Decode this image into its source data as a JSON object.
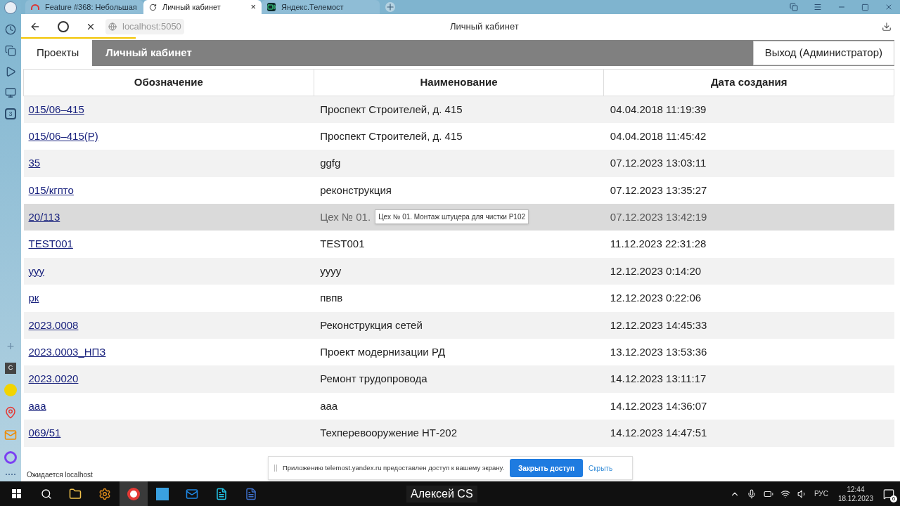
{
  "browser": {
    "tabs": [
      {
        "title": "Feature #368: Небольшая",
        "selected": false
      },
      {
        "title": "Личный кабинет",
        "selected": true,
        "close": "×"
      },
      {
        "title": "Яндекс.Телемост",
        "selected": false
      }
    ],
    "address": "localhost:5050",
    "page_title": "Личный кабинет",
    "load": {
      "level": 0.13
    },
    "status": "Ожидается localhost"
  },
  "page": {
    "tabs": [
      {
        "label": "Проекты",
        "selected": true
      },
      {
        "label": "Личный кабинет",
        "selected": false
      }
    ],
    "logout_button": "Выход (Администратор)",
    "table": {
      "columns": [
        "Обозначение",
        "Наименование",
        "Дата создания"
      ],
      "rows": [
        {
          "code": "015/06–415",
          "name": "Проспект Строителей, д. 415",
          "date": "04.04.2018 11:19:39",
          "hovered": false
        },
        {
          "code": "015/06–415(Р)",
          "name": "Проспект Строителей, д. 415",
          "date": "04.04.2018 11:45:42",
          "hovered": false
        },
        {
          "code": "35",
          "name": "ggfg",
          "date": "07.12.2023 13:03:11",
          "hovered": false
        },
        {
          "code": "015/кгпто",
          "name": "реконструкция",
          "date": "07.12.2023 13:35:27",
          "hovered": false
        },
        {
          "code": "20/113",
          "name": "Цех № 01.",
          "date": "07.12.2023 13:42:19",
          "hovered": true,
          "tooltip": "Цех № 01. Монтаж штуцера для чистки Р102"
        },
        {
          "code": "TEST001",
          "name": "TEST001",
          "date": "11.12.2023 22:31:28",
          "hovered": false
        },
        {
          "code": "ууу",
          "name": "уууу",
          "date": "12.12.2023 0:14:20",
          "hovered": false
        },
        {
          "code": "рк",
          "name": "пвпв",
          "date": "12.12.2023 0:22:06",
          "hovered": false
        },
        {
          "code": "2023.0008",
          "name": "Реконструкция сетей",
          "date": "12.12.2023 14:45:33",
          "hovered": false
        },
        {
          "code": "2023.0003_НПЗ",
          "name": "Проект модернизации РД",
          "date": "13.12.2023 13:53:36",
          "hovered": false
        },
        {
          "code": "2023.0020",
          "name": "Ремонт трудопровода",
          "date": "14.12.2023 13:11:17",
          "hovered": false
        },
        {
          "code": "ааа",
          "name": "ааа",
          "date": "14.12.2023 14:36:07",
          "hovered": false
        },
        {
          "code": "069/51",
          "name": "Техперевооружение НТ-202",
          "date": "14.12.2023 14:47:51",
          "hovered": false
        }
      ]
    }
  },
  "notification": {
    "text": "Приложению telemost.yandex.ru предоставлен доступ к вашему экрану.",
    "primary_button": "Закрыть доступ",
    "link": "Скрыть"
  },
  "sidebar": {
    "badge": "3",
    "add": "+",
    "mail_letter": "C"
  },
  "taskbar": {
    "user": "Алексей CS",
    "language": "РУС",
    "time": "12:44",
    "date": "18.12.2023",
    "notifications": "6"
  }
}
